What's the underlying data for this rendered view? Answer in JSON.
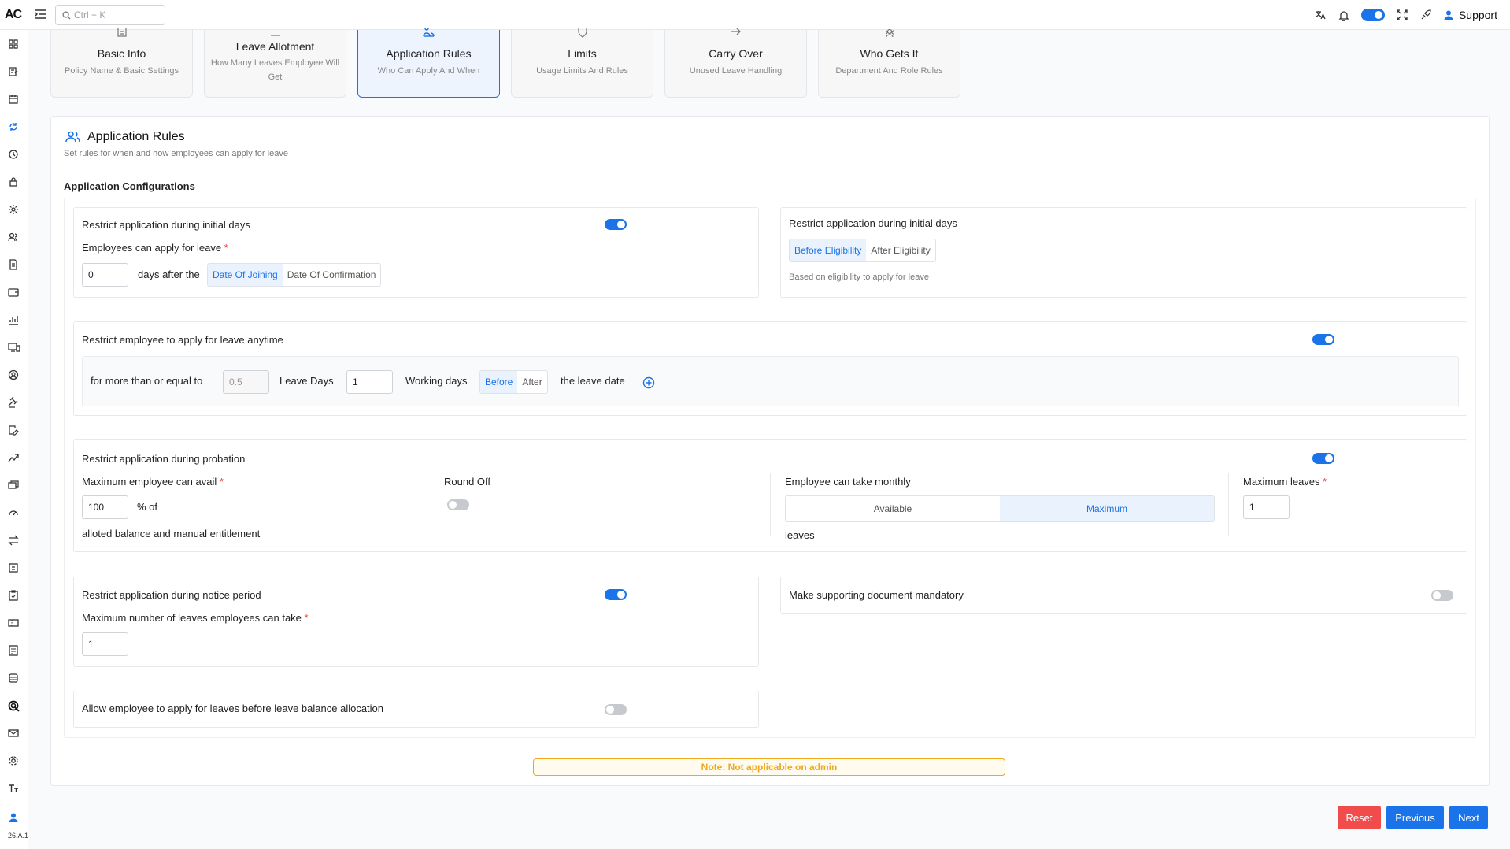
{
  "topbar": {
    "logo": "AC",
    "search_placeholder": "Ctrl + K",
    "support_label": "Support"
  },
  "sidebar": {
    "version": "26.A.1"
  },
  "steps": [
    {
      "title": "Basic Info",
      "subtitle": "Policy Name & Basic Settings"
    },
    {
      "title": "Leave Allotment",
      "subtitle": "How Many Leaves Employee Will Get"
    },
    {
      "title": "Application Rules",
      "subtitle": "Who Can Apply And When"
    },
    {
      "title": "Limits",
      "subtitle": "Usage Limits And Rules"
    },
    {
      "title": "Carry Over",
      "subtitle": "Unused Leave Handling"
    },
    {
      "title": "Who Gets It",
      "subtitle": "Department And Role Rules"
    }
  ],
  "panel": {
    "title": "Application Rules",
    "subtitle": "Set rules for when and how employees can apply for leave",
    "section_title": "Application Configurations"
  },
  "initial_days": {
    "title": "Restrict application during initial days",
    "enabled": true,
    "field_label": "Employees can apply for leave",
    "value": "0",
    "after_text": "days after the",
    "options": [
      "Date Of Joining",
      "Date Of Confirmation"
    ],
    "selected": "Date Of Joining"
  },
  "eligibility": {
    "title": "Restrict application during initial days",
    "options": [
      "Before Eligibility",
      "After Eligibility"
    ],
    "selected": "Before Eligibility",
    "hint": "Based on eligibility to apply for leave"
  },
  "anytime": {
    "title": "Restrict employee to apply for leave anytime",
    "enabled": true,
    "prefix": "for more than or equal to",
    "leave_days_value": "0.5",
    "leave_days_label": "Leave Days",
    "working_days_value": "1",
    "working_days_label": "Working days",
    "options": [
      "Before",
      "After"
    ],
    "selected": "Before",
    "suffix": "the leave date"
  },
  "probation": {
    "title": "Restrict application during probation",
    "enabled": true,
    "max_avail_label": "Maximum employee can avail",
    "max_avail_value": "100",
    "percent_text": "% of",
    "balance_text": "alloted balance and manual entitlement",
    "round_off_label": "Round Off",
    "round_off": false,
    "monthly_label": "Employee can take monthly",
    "monthly_options": [
      "Available",
      "Maximum"
    ],
    "monthly_selected": "Maximum",
    "leaves_text": "leaves",
    "max_leaves_label": "Maximum leaves",
    "max_leaves_value": "1"
  },
  "notice": {
    "title": "Restrict application during notice period",
    "enabled": true,
    "field_label": "Maximum number of leaves employees can take",
    "value": "1"
  },
  "document": {
    "title": "Make supporting document mandatory",
    "enabled": false
  },
  "before_allocation": {
    "title": "Allow employee to apply for leaves before leave balance allocation",
    "enabled": false
  },
  "note": "Note: Not applicable on admin",
  "buttons": {
    "reset": "Reset",
    "previous": "Previous",
    "next": "Next"
  },
  "colors": {
    "accent": "#1a73e8",
    "danger": "#f04c4c",
    "warning": "#f0a81c"
  }
}
